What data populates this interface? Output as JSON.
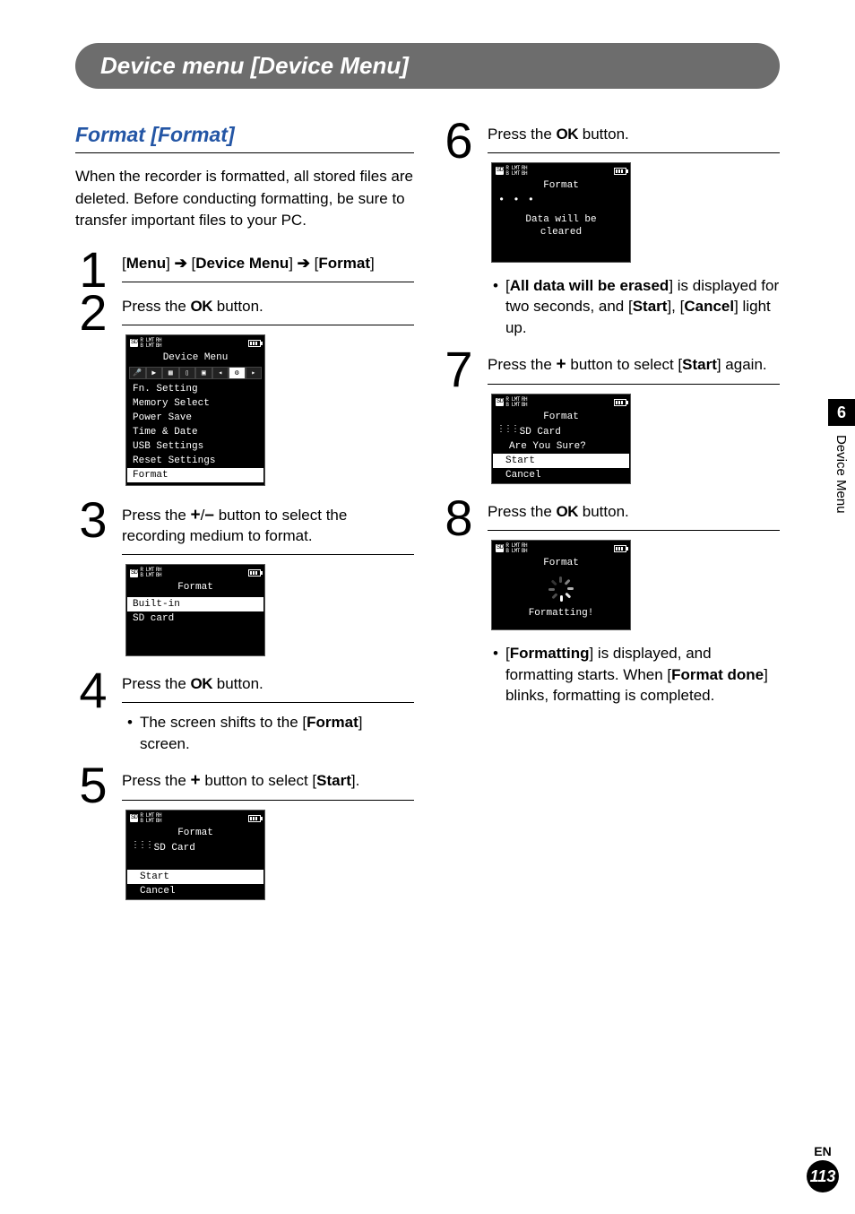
{
  "header": {
    "title": "Device menu [Device Menu]"
  },
  "section": {
    "heading": "Format [Format]",
    "intro": "When the recorder is formatted, all stored files are deleted. Before conducting formatting, be sure to transfer important files to your PC."
  },
  "arrow": "➔",
  "steps": {
    "s1": {
      "num": "1",
      "menu": "Menu",
      "device": "Device Menu",
      "format": "Format"
    },
    "s2": {
      "num": "2",
      "pre": "Press the ",
      "ok": "OK",
      "post": " button."
    },
    "s3": {
      "num": "3",
      "pre": "Press the ",
      "plus": "+",
      "slash": "/",
      "minus": "–",
      "post": " button to select the recording medium to format."
    },
    "s4": {
      "num": "4",
      "pre": "Press the ",
      "ok": "OK",
      "post": " button.",
      "bullet1a": "The screen shifts to the [",
      "bullet1b": "Format",
      "bullet1c": "] screen."
    },
    "s5": {
      "num": "5",
      "pre": "Press the ",
      "plus": "+",
      "mid": " button to select [",
      "start": "Start",
      "post": "]."
    },
    "s6": {
      "num": "6",
      "pre": "Press the ",
      "ok": "OK",
      "post": " button.",
      "b1a": "[",
      "b1b": "All data will be erased",
      "b1c": "] is displayed for two seconds, and [",
      "b1d": "Start",
      "b1e": "], [",
      "b1f": "Cancel",
      "b1g": "] light up."
    },
    "s7": {
      "num": "7",
      "pre": "Press the ",
      "plus": "+",
      "mid": " button to select [",
      "start": "Start",
      "post": "] again."
    },
    "s8": {
      "num": "8",
      "pre": "Press the ",
      "ok": "OK",
      "post": " button.",
      "b1a": "[",
      "b1b": "Formatting",
      "b1c": "] is displayed, and formatting starts. When [",
      "b1d": "Format done",
      "b1e": "] blinks, formatting is completed."
    }
  },
  "lcd": {
    "status": {
      "sd": "SD",
      "lmt1": "R LMT",
      "lmt2": "B LMT",
      "rh1": "RH",
      "rh2": "BH"
    },
    "device_menu": {
      "title": "Device Menu",
      "items": [
        "Fn. Setting",
        "Memory Select",
        "Power Save",
        "Time & Date",
        "USB Settings",
        "Reset Settings",
        "Format"
      ]
    },
    "format_media": {
      "title": "Format",
      "items": [
        "Built-in",
        "SD card"
      ]
    },
    "format_start": {
      "title": "Format",
      "line1": "SD Card",
      "start": "Start",
      "cancel": "Cancel"
    },
    "format_clear": {
      "title": "Format",
      "msg1": "Data will be",
      "msg2": "cleared"
    },
    "format_confirm": {
      "title": "Format",
      "line1": "SD Card",
      "line2": "Are You Sure?",
      "start": "Start",
      "cancel": "Cancel"
    },
    "format_progress": {
      "title": "Format",
      "msg": "Formatting!"
    }
  },
  "sidetab": {
    "chapter": "6",
    "label": "Device Menu"
  },
  "footer": {
    "lang": "EN",
    "page": "113"
  }
}
